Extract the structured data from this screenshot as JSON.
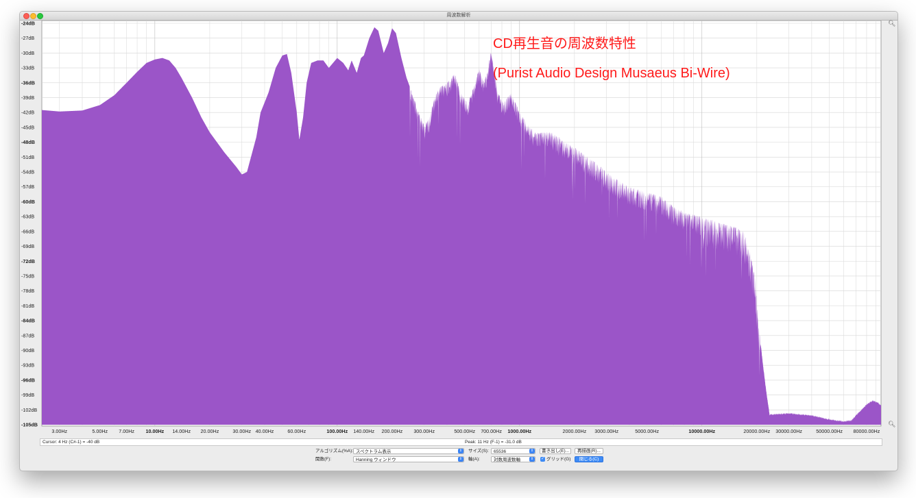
{
  "window": {
    "title": "周波数解析"
  },
  "annotation": {
    "line1": "CD再生音の周波数特性",
    "line2": "(Purist Audio Design Musaeus Bi-Wire)",
    "color": "#ff1a1a"
  },
  "icons": {
    "zoom_in": "magnifier-icon",
    "zoom_out": "magnifier-icon"
  },
  "status": {
    "cursor": "Cursor: 4 Hz (C#-1) = -40 dB",
    "peak": "Peak: 11 Hz (F-1) = -31.0 dB"
  },
  "controls": {
    "algorithm_label": "アルゴリズム(%A):",
    "algorithm_value": "スペクトラム表示",
    "function_label": "関数(F):",
    "function_value": "Hanning ウィンドウ",
    "size_label": "サイズ(S):",
    "size_value": "65536",
    "axis_label": "軸(A):",
    "axis_value": "対数周波数軸",
    "export_button": "書き出し(E)...",
    "redraw_button": "再描画(R)...",
    "grid_checkbox_label": "グリッド(G)",
    "grid_checked": true,
    "close_button": "閉じる(C)"
  },
  "chart_data": {
    "type": "area",
    "fill_color": "#9b55c8",
    "grid": true,
    "x_scale": "log",
    "xlim": [
      2.4,
      96000
    ],
    "ylim": [
      -105,
      -24
    ],
    "y_ticks": [
      -24,
      -27,
      -30,
      -33,
      -36,
      -39,
      -42,
      -45,
      -48,
      -51,
      -54,
      -57,
      -60,
      -63,
      -66,
      -69,
      -72,
      -75,
      -78,
      -81,
      -84,
      -87,
      -90,
      -93,
      -96,
      -99,
      -102,
      -105
    ],
    "y_tick_labels": [
      "-24dB",
      "-27dB",
      "-30dB",
      "-33dB",
      "-36dB",
      "-39dB",
      "-42dB",
      "-45dB",
      "-48dB",
      "-51dB",
      "-54dB",
      "-57dB",
      "-60dB",
      "-63dB",
      "-66dB",
      "-69dB",
      "-72dB",
      "-75dB",
      "-78dB",
      "-81dB",
      "-84dB",
      "-87dB",
      "-90dB",
      "-93dB",
      "-96dB",
      "-99dB",
      "-102dB",
      "-105dB"
    ],
    "y_bold_ticks": [
      -24,
      -36,
      -48,
      -60,
      -72,
      -84,
      -96,
      -105
    ],
    "x_ticks": [
      3,
      5,
      7,
      10,
      14,
      20,
      30,
      40,
      60,
      100,
      140,
      200,
      300,
      500,
      700,
      1000,
      2000,
      3000,
      5000,
      10000,
      20000,
      30000,
      50000,
      80000
    ],
    "x_tick_labels": [
      "3.00Hz",
      "5.00Hz",
      "7.00Hz",
      "10.00Hz",
      "14.00Hz",
      "20.00Hz",
      "30.00Hz",
      "40.00Hz",
      "60.00Hz",
      "100.00Hz",
      "140.00Hz",
      "200.00Hz",
      "300.00Hz",
      "500.00Hz",
      "700.00Hz",
      "1000.00Hz",
      "2000.00Hz",
      "3000.00Hz",
      "5000.00Hz",
      "10000.00Hz",
      "20000.00Hz",
      "30000.00Hz",
      "50000.00Hz",
      "80000.00Hz"
    ],
    "x_bold_ticks": [
      10,
      100,
      1000,
      10000
    ],
    "envelope": [
      [
        2.4,
        -41.5
      ],
      [
        3,
        -41.8
      ],
      [
        4,
        -41.6
      ],
      [
        5,
        -40.5
      ],
      [
        6,
        -38.5
      ],
      [
        7,
        -36
      ],
      [
        8,
        -33.8
      ],
      [
        9,
        -32
      ],
      [
        10,
        -31.3
      ],
      [
        11,
        -31
      ],
      [
        12,
        -31.5
      ],
      [
        13,
        -33
      ],
      [
        14,
        -35
      ],
      [
        16,
        -39
      ],
      [
        18,
        -43
      ],
      [
        20,
        -46
      ],
      [
        24,
        -50
      ],
      [
        28,
        -53
      ],
      [
        30,
        -54.5
      ],
      [
        32,
        -54
      ],
      [
        36,
        -47
      ],
      [
        38,
        -42
      ],
      [
        42,
        -38
      ],
      [
        46,
        -33
      ],
      [
        50,
        -30.5
      ],
      [
        53,
        -30.2
      ],
      [
        56,
        -34
      ],
      [
        60,
        -42
      ],
      [
        62,
        -47.5
      ],
      [
        65,
        -43
      ],
      [
        68,
        -36
      ],
      [
        72,
        -32
      ],
      [
        78,
        -31.5
      ],
      [
        84,
        -31.5
      ],
      [
        90,
        -33
      ],
      [
        100,
        -31
      ],
      [
        108,
        -32
      ],
      [
        115,
        -33.5
      ],
      [
        120,
        -31.5
      ],
      [
        128,
        -34
      ],
      [
        135,
        -31
      ],
      [
        140,
        -30.5
      ],
      [
        150,
        -27
      ],
      [
        160,
        -24.8
      ],
      [
        168,
        -25.5
      ],
      [
        180,
        -30
      ],
      [
        190,
        -28
      ],
      [
        200,
        -25
      ],
      [
        210,
        -26
      ],
      [
        225,
        -31
      ],
      [
        240,
        -35
      ],
      [
        260,
        -38.5
      ],
      [
        280,
        -42
      ],
      [
        300,
        -44.5
      ],
      [
        320,
        -43
      ],
      [
        340,
        -39
      ],
      [
        360,
        -37
      ],
      [
        400,
        -36
      ],
      [
        440,
        -34
      ],
      [
        480,
        -38
      ],
      [
        520,
        -40
      ],
      [
        560,
        -37
      ],
      [
        600,
        -33
      ],
      [
        640,
        -36
      ],
      [
        700,
        -29.5
      ],
      [
        760,
        -38
      ],
      [
        820,
        -40
      ],
      [
        900,
        -38
      ],
      [
        1000,
        -42
      ],
      [
        1200,
        -46
      ],
      [
        1500,
        -46
      ],
      [
        2000,
        -49
      ],
      [
        2600,
        -52
      ],
      [
        3000,
        -54
      ],
      [
        4000,
        -57
      ],
      [
        5000,
        -58
      ],
      [
        6000,
        -59
      ],
      [
        7000,
        -61
      ],
      [
        8000,
        -62
      ],
      [
        10000,
        -63
      ],
      [
        12000,
        -64
      ],
      [
        15000,
        -65
      ],
      [
        17000,
        -66
      ],
      [
        18500,
        -71
      ],
      [
        19500,
        -75
      ],
      [
        20500,
        -85
      ],
      [
        21500,
        -92
      ],
      [
        22500,
        -98
      ],
      [
        23500,
        -102.8
      ],
      [
        30000,
        -102.6
      ],
      [
        40000,
        -103
      ],
      [
        50000,
        -103.8
      ],
      [
        60000,
        -104.2
      ],
      [
        66000,
        -104
      ],
      [
        72000,
        -102.5
      ],
      [
        80000,
        -100.8
      ],
      [
        86000,
        -100
      ],
      [
        92000,
        -100.4
      ],
      [
        96000,
        -101
      ]
    ]
  }
}
